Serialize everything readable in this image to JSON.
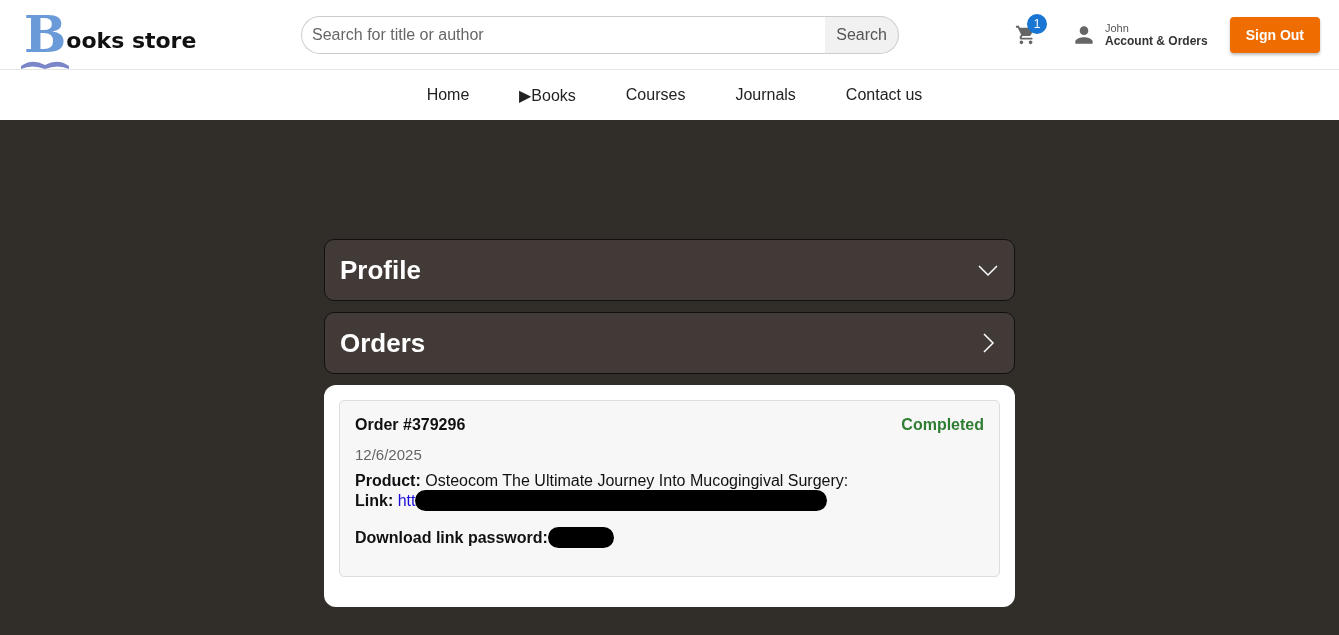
{
  "header": {
    "logo": {
      "initial": "B",
      "rest": "ooks store"
    },
    "search": {
      "placeholder": "Search for title or author",
      "button": "Search"
    },
    "cart": {
      "count": "1"
    },
    "account": {
      "name": "John",
      "label": "Account & Orders"
    },
    "sign_out": "Sign Out"
  },
  "nav": [
    {
      "label": "Home"
    },
    {
      "label": "Books",
      "marker": "▶"
    },
    {
      "label": "Courses"
    },
    {
      "label": "Journals"
    },
    {
      "label": "Contact us"
    }
  ],
  "sections": [
    {
      "title": "Profile",
      "expanded": true
    },
    {
      "title": "Orders",
      "expanded": false
    }
  ],
  "order": {
    "title": "Order #379296",
    "status": "Completed",
    "date": "12/6/2025",
    "product_label": "Product:",
    "product": "Osteocom The Ultimate Journey Into Mucogingival Surgery:",
    "link_label": "Link:",
    "link": "htt",
    "password_label": "Download link password:"
  }
}
